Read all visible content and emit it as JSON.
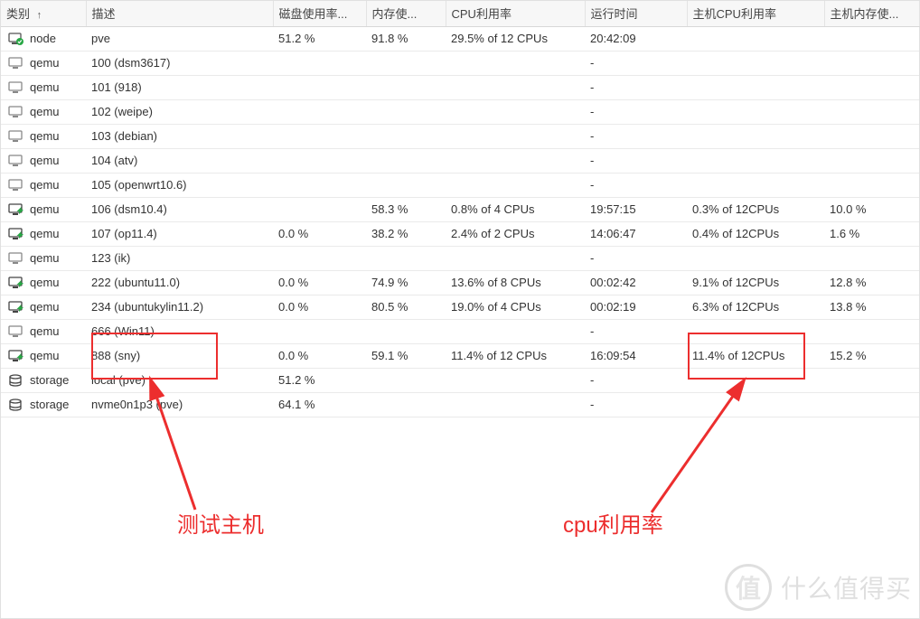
{
  "headers": {
    "type": "类别",
    "desc": "描述",
    "disk": "磁盘使用率...",
    "mem": "内存使...",
    "cpu": "CPU利用率",
    "uptime": "运行时间",
    "hostcpu": "主机CPU利用率",
    "hostmem": "主机内存使..."
  },
  "sort_arrow": "↑",
  "rows": [
    {
      "icon": "node-on",
      "type": "node",
      "desc": "pve",
      "disk": "51.2 %",
      "mem": "91.8 %",
      "cpu": "29.5% of 12 CPUs",
      "up": "20:42:09",
      "hcpu": "",
      "hmem": ""
    },
    {
      "icon": "vm-off",
      "type": "qemu",
      "desc": "100 (dsm3617)",
      "disk": "",
      "mem": "",
      "cpu": "",
      "up": "-",
      "hcpu": "",
      "hmem": ""
    },
    {
      "icon": "vm-off",
      "type": "qemu",
      "desc": "101 (918)",
      "disk": "",
      "mem": "",
      "cpu": "",
      "up": "-",
      "hcpu": "",
      "hmem": ""
    },
    {
      "icon": "vm-off",
      "type": "qemu",
      "desc": "102 (weipe)",
      "disk": "",
      "mem": "",
      "cpu": "",
      "up": "-",
      "hcpu": "",
      "hmem": ""
    },
    {
      "icon": "vm-off",
      "type": "qemu",
      "desc": "103 (debian)",
      "disk": "",
      "mem": "",
      "cpu": "",
      "up": "-",
      "hcpu": "",
      "hmem": ""
    },
    {
      "icon": "vm-off",
      "type": "qemu",
      "desc": "104 (atv)",
      "disk": "",
      "mem": "",
      "cpu": "",
      "up": "-",
      "hcpu": "",
      "hmem": ""
    },
    {
      "icon": "vm-off",
      "type": "qemu",
      "desc": "105 (openwrt10.6)",
      "disk": "",
      "mem": "",
      "cpu": "",
      "up": "-",
      "hcpu": "",
      "hmem": ""
    },
    {
      "icon": "vm-on",
      "type": "qemu",
      "desc": "106 (dsm10.4)",
      "disk": "",
      "mem": "58.3 %",
      "cpu": "0.8% of 4 CPUs",
      "up": "19:57:15",
      "hcpu": "0.3% of 12CPUs",
      "hmem": "10.0 %"
    },
    {
      "icon": "vm-on",
      "type": "qemu",
      "desc": "107 (op11.4)",
      "disk": "0.0 %",
      "mem": "38.2 %",
      "cpu": "2.4% of 2 CPUs",
      "up": "14:06:47",
      "hcpu": "0.4% of 12CPUs",
      "hmem": "1.6 %"
    },
    {
      "icon": "vm-off",
      "type": "qemu",
      "desc": "123 (ik)",
      "disk": "",
      "mem": "",
      "cpu": "",
      "up": "-",
      "hcpu": "",
      "hmem": ""
    },
    {
      "icon": "vm-on",
      "type": "qemu",
      "desc": "222 (ubuntu11.0)",
      "disk": "0.0 %",
      "mem": "74.9 %",
      "cpu": "13.6% of 8 CPUs",
      "up": "00:02:42",
      "hcpu": "9.1% of 12CPUs",
      "hmem": "12.8 %"
    },
    {
      "icon": "vm-on",
      "type": "qemu",
      "desc": "234 (ubuntukylin11.2)",
      "disk": "0.0 %",
      "mem": "80.5 %",
      "cpu": "19.0% of 4 CPUs",
      "up": "00:02:19",
      "hcpu": "6.3% of 12CPUs",
      "hmem": "13.8 %"
    },
    {
      "icon": "vm-off",
      "type": "qemu",
      "desc": "666 (Win11)",
      "disk": "",
      "mem": "",
      "cpu": "",
      "up": "-",
      "hcpu": "",
      "hmem": ""
    },
    {
      "icon": "vm-on",
      "type": "qemu",
      "desc": "888 (sny)",
      "disk": "0.0 %",
      "mem": "59.1 %",
      "cpu": "11.4% of 12 CPUs",
      "up": "16:09:54",
      "hcpu": "11.4% of 12CPUs",
      "hmem": "15.2 %"
    },
    {
      "icon": "storage",
      "type": "storage",
      "desc": "local (pve)",
      "disk": "51.2 %",
      "mem": "",
      "cpu": "",
      "up": "-",
      "hcpu": "",
      "hmem": ""
    },
    {
      "icon": "storage",
      "type": "storage",
      "desc": "nvme0n1p3 (pve)",
      "disk": "64.1 %",
      "mem": "",
      "cpu": "",
      "up": "-",
      "hcpu": "",
      "hmem": ""
    }
  ],
  "annotations": {
    "label1": "测试主机",
    "label2": "cpu利用率"
  },
  "watermark": {
    "char": "值",
    "text": "什么值得买"
  }
}
